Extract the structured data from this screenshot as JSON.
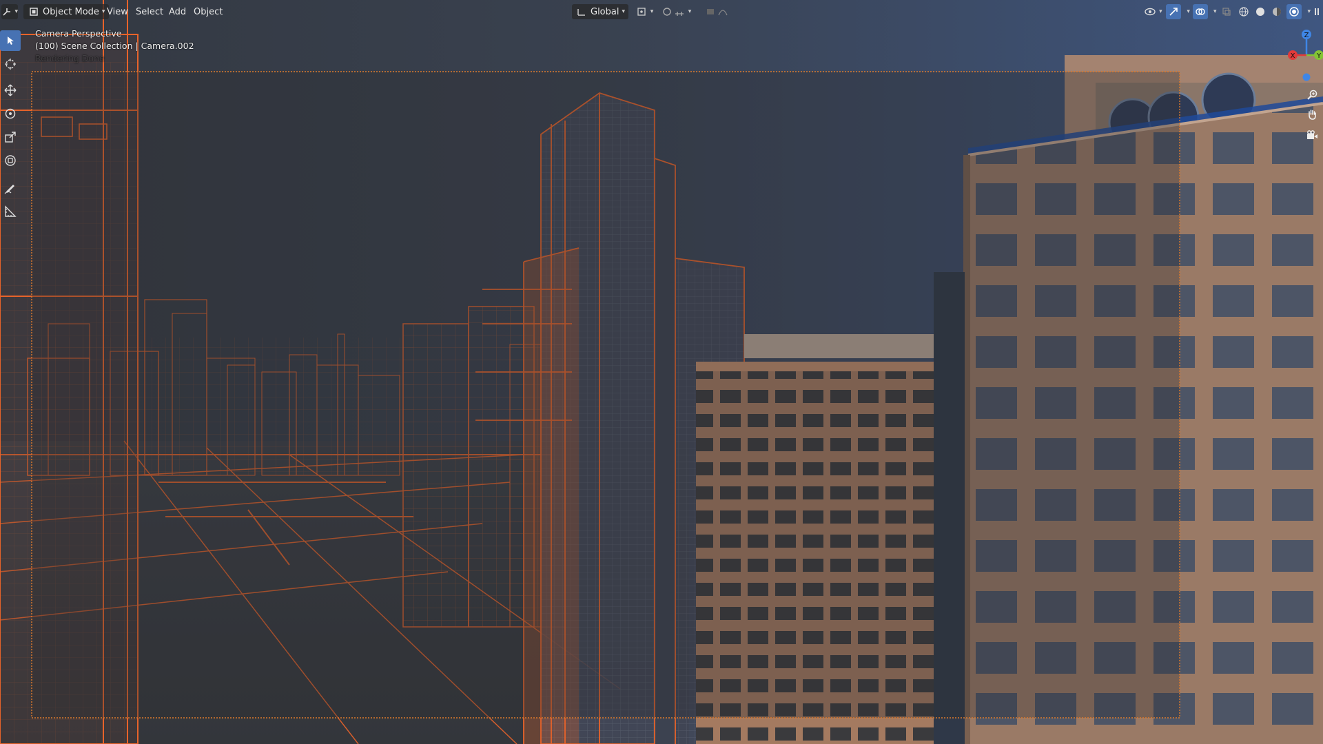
{
  "header": {
    "mode_label": "Object Mode",
    "menus": [
      "View",
      "Select",
      "Add",
      "Object"
    ],
    "transform_orientation": "Global"
  },
  "viewport_info": {
    "line1": "Camera Perspective",
    "line2": "(100) Scene Collection | Camera.002",
    "line3": "Rendering Done"
  },
  "gizmo": {
    "z": "Z",
    "y": "Y",
    "x": "X"
  },
  "colors": {
    "accent": "#4772b3",
    "wire": "#e8632a",
    "sky": "#3e5072",
    "header_bg": "#2b2b2b"
  },
  "tools": [
    "select-box-icon",
    "cursor-icon",
    "move-icon",
    "rotate-icon",
    "scale-icon",
    "transform-icon",
    "annotate-icon",
    "measure-icon"
  ],
  "nav_icons": [
    "zoom-icon",
    "hand-pan-icon",
    "camera-view-icon"
  ]
}
